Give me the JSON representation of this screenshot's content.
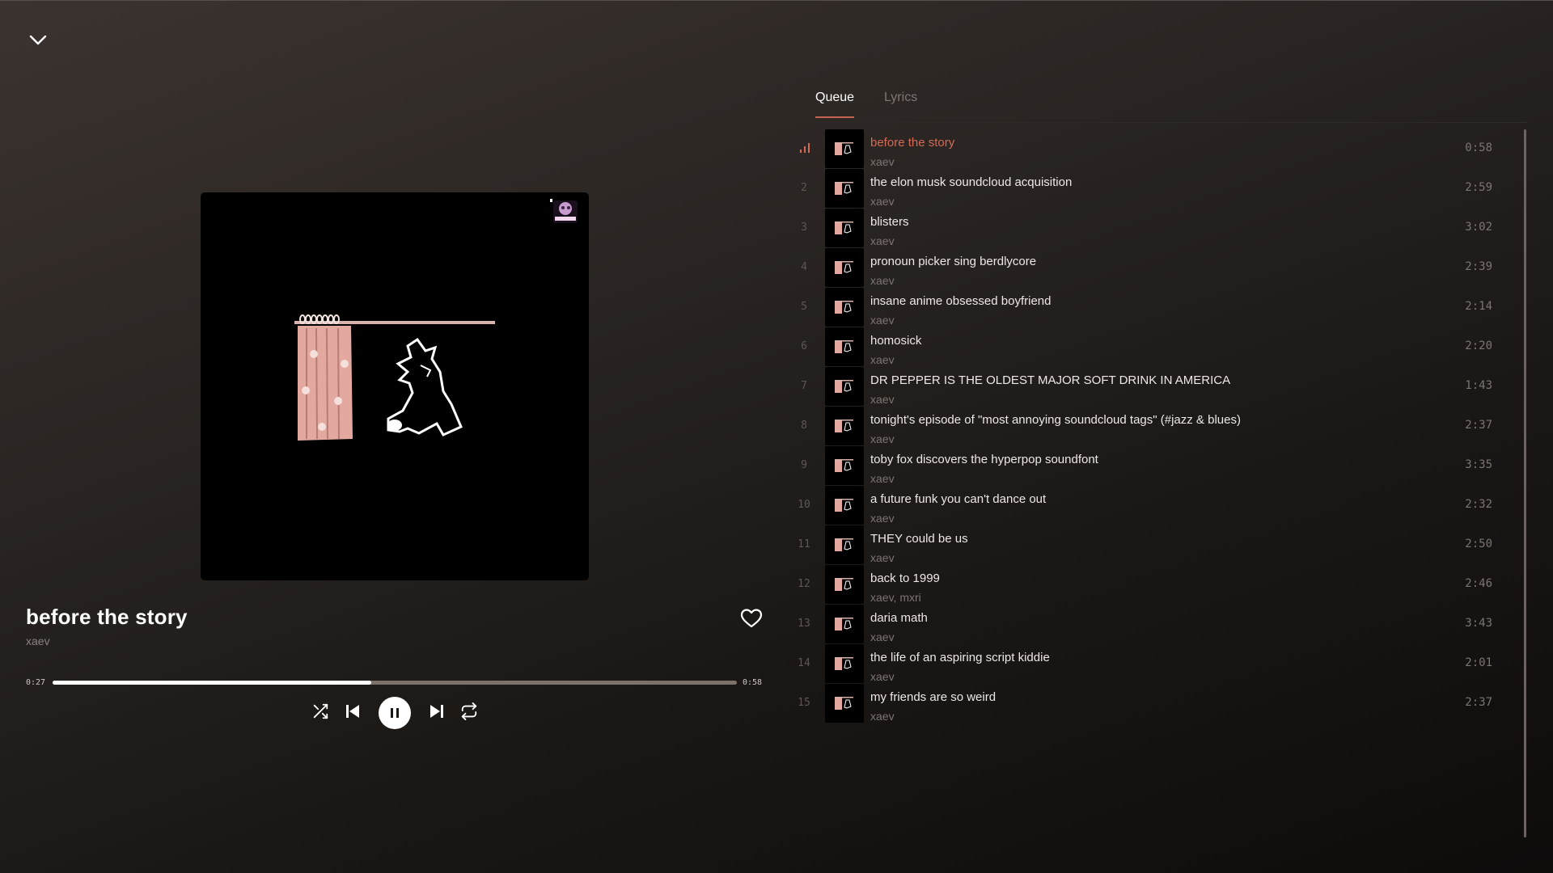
{
  "player": {
    "title": "before the story",
    "artist": "xaev",
    "elapsed": "0:27",
    "duration": "0:58",
    "progress": 0.4655
  },
  "tabs": [
    {
      "label": "Queue",
      "active": true
    },
    {
      "label": "Lyrics",
      "active": false
    }
  ],
  "queue": [
    {
      "num": "1",
      "title": "before the story",
      "artist": "xaev",
      "duration": "0:58",
      "playing": true
    },
    {
      "num": "2",
      "title": "the elon musk soundcloud acquisition",
      "artist": "xaev",
      "duration": "2:59"
    },
    {
      "num": "3",
      "title": "blisters",
      "artist": "xaev",
      "duration": "3:02"
    },
    {
      "num": "4",
      "title": "pronoun picker sing berdlycore",
      "artist": "xaev",
      "duration": "2:39"
    },
    {
      "num": "5",
      "title": "insane anime obsessed boyfriend",
      "artist": "xaev",
      "duration": "2:14"
    },
    {
      "num": "6",
      "title": "homosick",
      "artist": "xaev",
      "duration": "2:20"
    },
    {
      "num": "7",
      "title": "DR PEPPER IS THE OLDEST MAJOR SOFT DRINK IN AMERICA",
      "artist": "xaev",
      "duration": "1:43"
    },
    {
      "num": "8",
      "title": "tonight's episode of \"most annoying soundcloud tags\" (#jazz & blues)",
      "artist": "xaev",
      "duration": "2:37"
    },
    {
      "num": "9",
      "title": "toby fox discovers the hyperpop soundfont",
      "artist": "xaev",
      "duration": "3:35"
    },
    {
      "num": "10",
      "title": "a future funk you can't dance out",
      "artist": "xaev",
      "duration": "2:32"
    },
    {
      "num": "11",
      "title": "THEY could be us",
      "artist": "xaev",
      "duration": "2:50"
    },
    {
      "num": "12",
      "title": "back to 1999",
      "artist": "xaev, mxri",
      "duration": "2:46"
    },
    {
      "num": "13",
      "title": "daria math",
      "artist": "xaev",
      "duration": "3:43"
    },
    {
      "num": "14",
      "title": "the life of an aspiring script kiddie",
      "artist": "xaev",
      "duration": "2:01"
    },
    {
      "num": "15",
      "title": "my friends are so weird",
      "artist": "xaev",
      "duration": "2:37"
    }
  ],
  "icons": {
    "collapse": "chevron-down-icon",
    "like": "heart-icon",
    "shuffle": "shuffle-icon",
    "previous": "skip-previous-icon",
    "play_pause": "pause-icon",
    "next": "skip-next-icon",
    "repeat": "repeat-icon",
    "now_playing": "equalizer-bars-icon"
  },
  "colors": {
    "accent": "#d46a55",
    "tab_underline": "#c56350",
    "progress_fill": "#ffffff",
    "progress_track": "#7d716b"
  }
}
